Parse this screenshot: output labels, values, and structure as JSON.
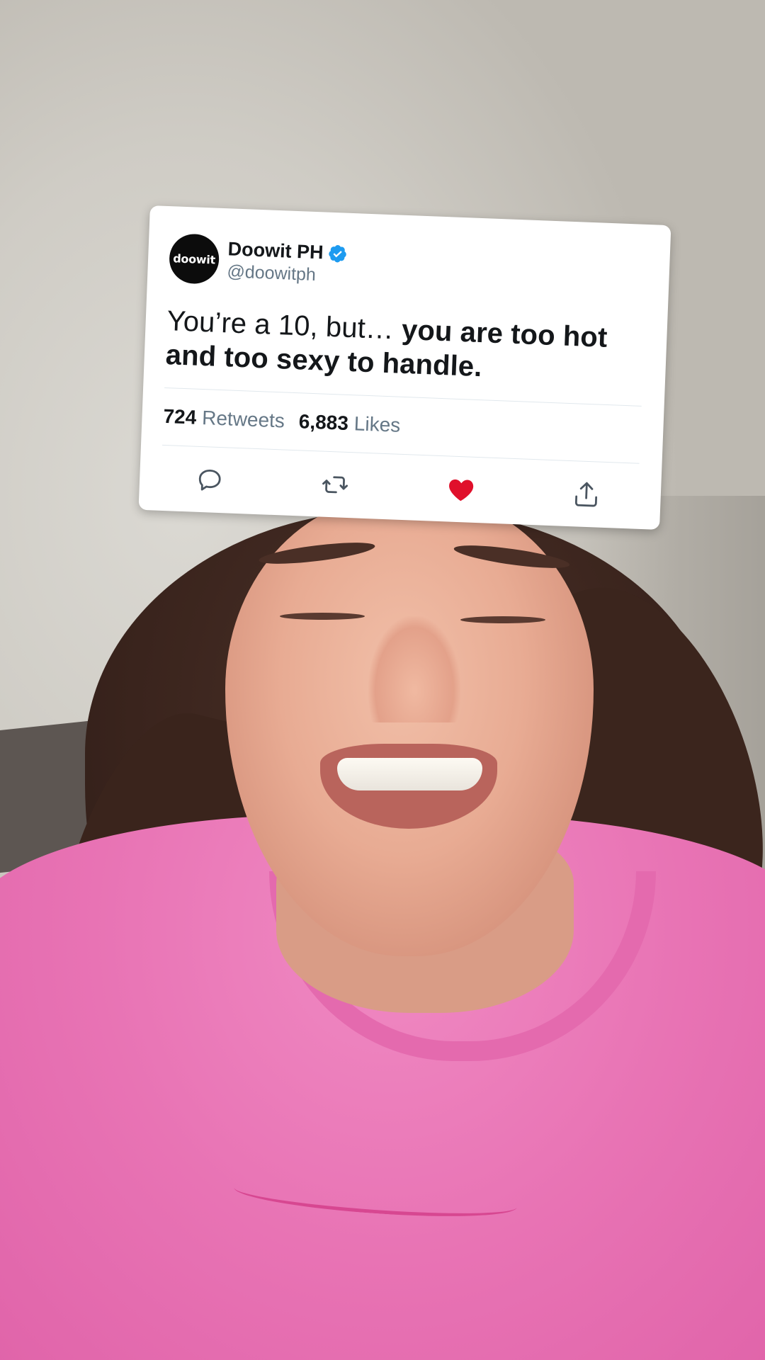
{
  "tweet": {
    "avatar_text": "doowit",
    "display_name": "Doowit PH",
    "handle": "@doowitph",
    "text_normal": "You’re a 10, but… ",
    "text_bold": "you are too hot and too sexy to handle.",
    "retweets_count": "724",
    "retweets_label": "Retweets",
    "likes_count": "6,883",
    "likes_label": "Likes",
    "liked": true
  },
  "icons": {
    "verified": "verified-badge-icon",
    "reply": "reply-icon",
    "retweet": "retweet-icon",
    "like": "heart-icon",
    "share": "share-icon"
  },
  "colors": {
    "verified_blue": "#1d9bf0",
    "like_red": "#e0245e",
    "icon_gray": "#657786",
    "shirt_pink": "#e873b4"
  }
}
